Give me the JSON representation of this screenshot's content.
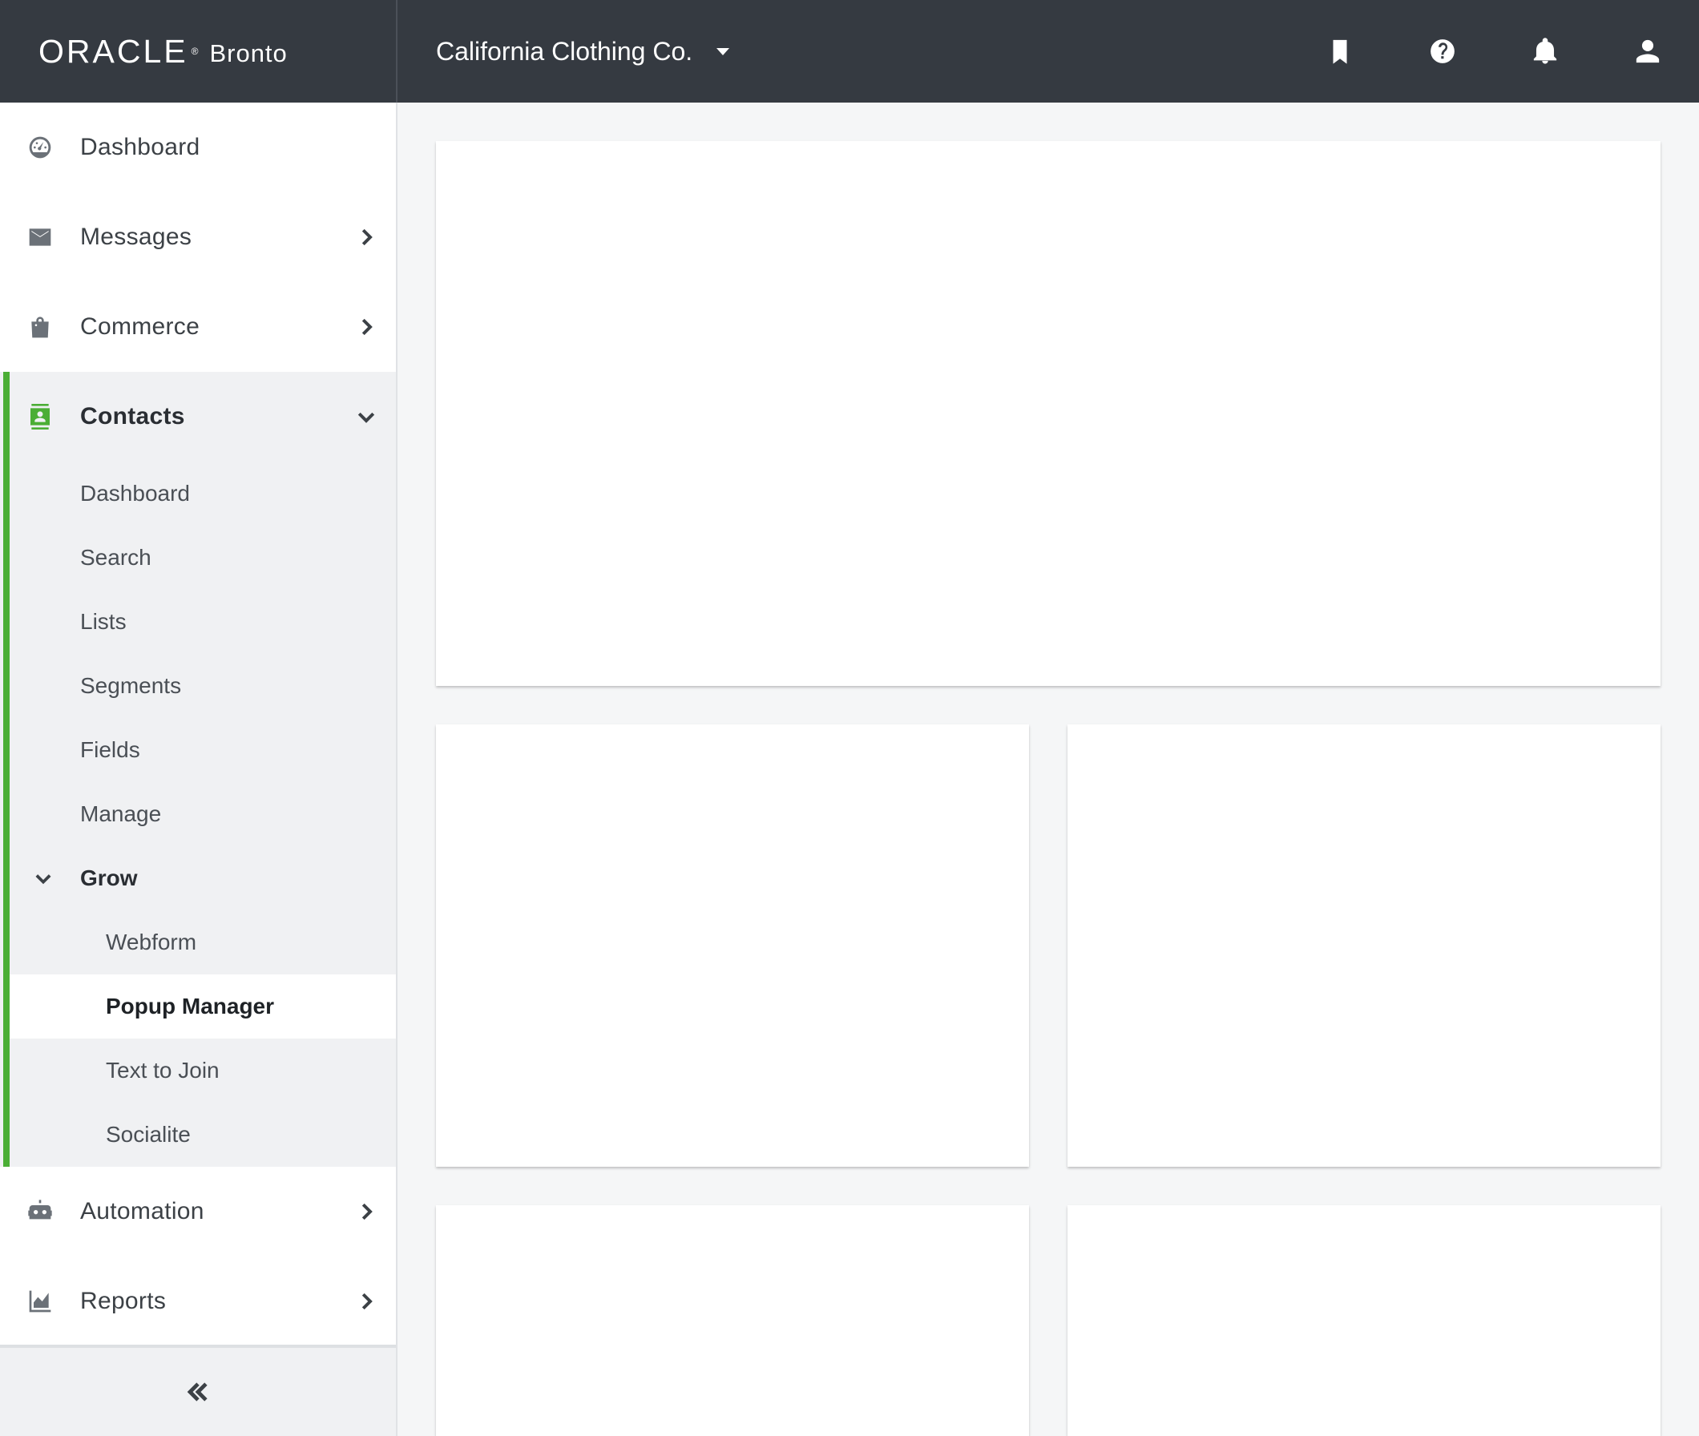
{
  "brand": {
    "oracle": "ORACLE",
    "product": "Bronto"
  },
  "account": {
    "name": "California Clothing Co."
  },
  "top_icons": [
    "bookmark-icon",
    "help-icon",
    "bell-icon",
    "user-icon"
  ],
  "sidebar": {
    "items": [
      {
        "label": "Dashboard",
        "icon": "dashboard-gauge-icon"
      },
      {
        "label": "Messages",
        "icon": "envelope-icon"
      },
      {
        "label": "Commerce",
        "icon": "shopping-bag-icon"
      },
      {
        "label": "Contacts",
        "icon": "contacts-card-icon"
      },
      {
        "label": "Automation",
        "icon": "robot-icon"
      },
      {
        "label": "Reports",
        "icon": "chart-icon"
      }
    ],
    "contacts_sub": [
      {
        "label": "Dashboard"
      },
      {
        "label": "Search"
      },
      {
        "label": "Lists"
      },
      {
        "label": "Segments"
      },
      {
        "label": "Fields"
      },
      {
        "label": "Manage"
      },
      {
        "label": "Grow"
      }
    ],
    "grow_sub": [
      {
        "label": "Webform"
      },
      {
        "label": "Popup Manager"
      },
      {
        "label": "Text to Join"
      },
      {
        "label": "Socialite"
      }
    ],
    "active_item": "Popup Manager",
    "accent_color": "#4bae35"
  },
  "colors": {
    "topbar": "#353a41",
    "background": "#f5f6f7"
  }
}
